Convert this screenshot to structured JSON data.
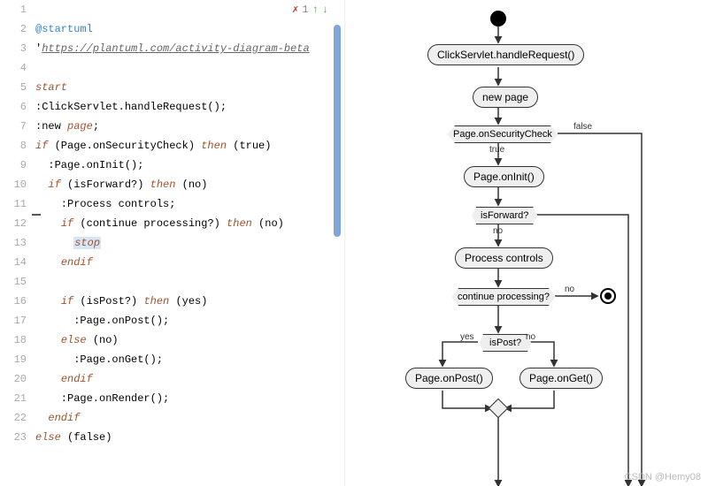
{
  "editor": {
    "markers": {
      "check": "✗",
      "count": "1",
      "up": "↑",
      "down": "↓"
    },
    "lines": [
      {
        "n": 1,
        "parts": []
      },
      {
        "n": 2,
        "parts": [
          {
            "t": "@startuml",
            "c": "startuml"
          }
        ]
      },
      {
        "n": 3,
        "parts": [
          {
            "t": "'",
            "c": ""
          },
          {
            "t": "https://plantuml.com/activity-diagram-beta",
            "c": "url"
          }
        ]
      },
      {
        "n": 4,
        "parts": []
      },
      {
        "n": 5,
        "parts": [
          {
            "t": "start",
            "c": "kw"
          }
        ]
      },
      {
        "n": 6,
        "parts": [
          {
            "t": ":ClickServlet.handleRequest();",
            "c": ""
          }
        ]
      },
      {
        "n": 7,
        "parts": [
          {
            "t": ":new ",
            "c": ""
          },
          {
            "t": "page",
            "c": "kw"
          },
          {
            "t": ";",
            "c": ""
          }
        ]
      },
      {
        "n": 8,
        "parts": [
          {
            "t": "if",
            "c": "kw"
          },
          {
            "t": " (Page.onSecurityCheck) ",
            "c": ""
          },
          {
            "t": "then",
            "c": "kw"
          },
          {
            "t": " (true)",
            "c": ""
          }
        ]
      },
      {
        "n": 9,
        "parts": [
          {
            "t": "  :Page.onInit();",
            "c": ""
          }
        ]
      },
      {
        "n": 10,
        "parts": [
          {
            "t": "  ",
            "c": ""
          },
          {
            "t": "if",
            "c": "kw"
          },
          {
            "t": " (isForward?) ",
            "c": ""
          },
          {
            "t": "then",
            "c": "kw"
          },
          {
            "t": " (no)",
            "c": ""
          }
        ]
      },
      {
        "n": 11,
        "parts": [
          {
            "t": "    :Process controls;",
            "c": ""
          }
        ]
      },
      {
        "n": 12,
        "parts": [
          {
            "t": "    ",
            "c": ""
          },
          {
            "t": "if",
            "c": "kw"
          },
          {
            "t": " (continue processing?) ",
            "c": ""
          },
          {
            "t": "then",
            "c": "kw"
          },
          {
            "t": " (no)",
            "c": ""
          }
        ]
      },
      {
        "n": 13,
        "parts": [
          {
            "t": "      ",
            "c": ""
          },
          {
            "t": "stop",
            "c": "kw cursor-box"
          }
        ]
      },
      {
        "n": 14,
        "parts": [
          {
            "t": "    ",
            "c": ""
          },
          {
            "t": "endif",
            "c": "kw"
          }
        ]
      },
      {
        "n": 15,
        "parts": []
      },
      {
        "n": 16,
        "parts": [
          {
            "t": "    ",
            "c": ""
          },
          {
            "t": "if",
            "c": "kw"
          },
          {
            "t": " (isPost?) ",
            "c": ""
          },
          {
            "t": "then",
            "c": "kw"
          },
          {
            "t": " (yes)",
            "c": ""
          }
        ]
      },
      {
        "n": 17,
        "parts": [
          {
            "t": "      :Page.onPost();",
            "c": ""
          }
        ]
      },
      {
        "n": 18,
        "parts": [
          {
            "t": "    ",
            "c": ""
          },
          {
            "t": "else",
            "c": "kw"
          },
          {
            "t": " (no)",
            "c": ""
          }
        ]
      },
      {
        "n": 19,
        "parts": [
          {
            "t": "      :Page.onGet();",
            "c": ""
          }
        ]
      },
      {
        "n": 20,
        "parts": [
          {
            "t": "    ",
            "c": ""
          },
          {
            "t": "endif",
            "c": "kw"
          }
        ]
      },
      {
        "n": 21,
        "parts": [
          {
            "t": "    :Page.onRender();",
            "c": ""
          }
        ]
      },
      {
        "n": 22,
        "parts": [
          {
            "t": "  ",
            "c": ""
          },
          {
            "t": "endif",
            "c": "kw"
          }
        ]
      },
      {
        "n": 23,
        "parts": [
          {
            "t": "else",
            "c": "kw"
          },
          {
            "t": " (false)",
            "c": ""
          }
        ]
      }
    ]
  },
  "diagram": {
    "nodes": {
      "handle": "ClickServlet.handleRequest()",
      "newpage": "new page",
      "sec": "Page.onSecurityCheck",
      "init": "Page.onInit()",
      "fwd": "isForward?",
      "proc": "Process controls",
      "cont": "continue processing?",
      "post": "isPost?",
      "onpost": "Page.onPost()",
      "onget": "Page.onGet()"
    },
    "labels": {
      "false": "false",
      "true": "true",
      "no1": "no",
      "no2": "no",
      "yes": "yes",
      "no3": "no"
    }
  },
  "watermark": "CSDN @Hemy08"
}
